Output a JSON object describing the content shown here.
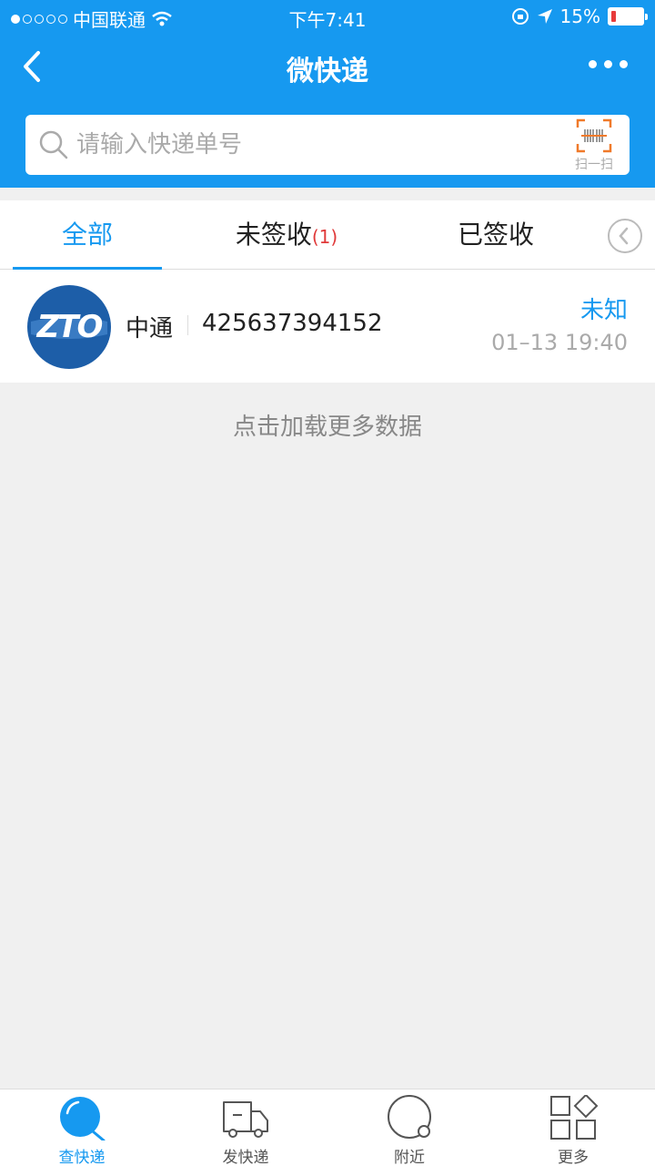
{
  "status_bar": {
    "carrier": "中国联通",
    "time": "下午7:41",
    "battery_text": "15%",
    "battery_level": 0.15
  },
  "nav": {
    "title": "微快递"
  },
  "search": {
    "placeholder": "请输入快递单号",
    "scan_label": "扫一扫"
  },
  "tabs": [
    {
      "label": "全部"
    },
    {
      "label": "未签收",
      "badge": "(1)"
    },
    {
      "label": "已签收"
    }
  ],
  "items": [
    {
      "logo_text": "ZTO",
      "company": "中通",
      "tracking_number": "425637394152",
      "status": "未知",
      "time": "01–13 19:40"
    }
  ],
  "load_more": "点击加载更多数据",
  "bottom_nav": [
    {
      "label": "查快递",
      "icon": "search-icon"
    },
    {
      "label": "发快递",
      "icon": "truck-icon"
    },
    {
      "label": "附近",
      "icon": "nearby-icon"
    },
    {
      "label": "更多",
      "icon": "grid-icon"
    }
  ],
  "colors": {
    "primary": "#1699f0",
    "badge": "#e03a3a",
    "scan_accent": "#f07a2a"
  }
}
